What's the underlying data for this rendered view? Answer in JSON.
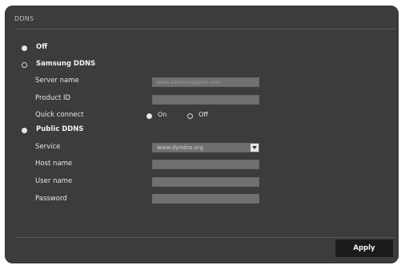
{
  "panel": {
    "title": "DDNS"
  },
  "options": {
    "off_label": "Off",
    "samsung_label": "Samsung DDNS",
    "public_label": "Public DDNS"
  },
  "samsung": {
    "server_name_label": "Server name",
    "server_name_value": "www.samsungipolis.com",
    "product_id_label": "Product ID",
    "product_id_value": "",
    "quick_connect_label": "Quick connect",
    "quick_on_label": "On",
    "quick_off_label": "Off"
  },
  "public": {
    "service_label": "Service",
    "service_value": "www.dyndns.org",
    "host_name_label": "Host name",
    "user_name_label": "User name",
    "password_label": "Password"
  },
  "footer": {
    "apply_label": "Apply"
  }
}
